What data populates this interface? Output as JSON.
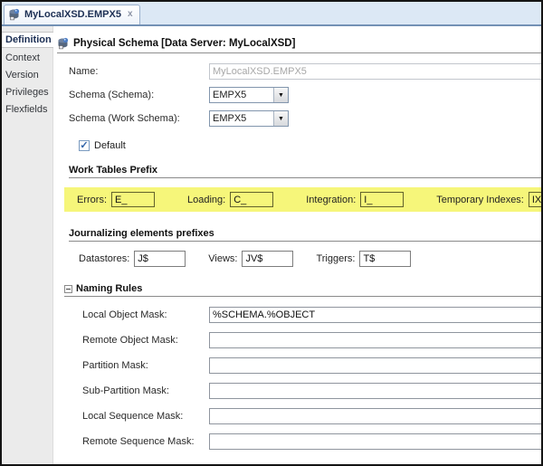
{
  "tab": {
    "title": "MyLocalXSD.EMPX5",
    "close_glyph": "x"
  },
  "sidebar": {
    "items": [
      {
        "label": "Definition",
        "active": true
      },
      {
        "label": "Context",
        "active": false
      },
      {
        "label": "Version",
        "active": false
      },
      {
        "label": "Privileges",
        "active": false
      },
      {
        "label": "Flexfields",
        "active": false
      }
    ]
  },
  "header": {
    "title": "Physical Schema [Data Server: MyLocalXSD]"
  },
  "form": {
    "name": {
      "label": "Name:",
      "value": "MyLocalXSD.EMPX5",
      "disabled": true
    },
    "schema": {
      "label": "Schema (Schema):",
      "value": "EMPX5"
    },
    "work_schema": {
      "label": "Schema (Work Schema):",
      "value": "EMPX5"
    },
    "default_checkbox": {
      "label": "Default",
      "checked": true,
      "check_glyph": "✓"
    },
    "work_tables_prefix": {
      "heading": "Work Tables Prefix",
      "fields": [
        {
          "label": "Errors:",
          "value": "E_"
        },
        {
          "label": "Loading:",
          "value": "C_"
        },
        {
          "label": "Integration:",
          "value": "I_"
        },
        {
          "label": "Temporary Indexes:",
          "value": "IX_"
        }
      ]
    },
    "journalizing": {
      "heading": "Journalizing elements prefixes",
      "fields": [
        {
          "label": "Datastores:",
          "value": "J$"
        },
        {
          "label": "Views:",
          "value": "JV$"
        },
        {
          "label": "Triggers:",
          "value": "T$"
        }
      ]
    },
    "naming_rules": {
      "heading": "Naming Rules",
      "collapsed": false,
      "fields": [
        {
          "label": "Local Object Mask:",
          "value": "%SCHEMA.%OBJECT"
        },
        {
          "label": "Remote Object Mask:",
          "value": ""
        },
        {
          "label": "Partition Mask:",
          "value": ""
        },
        {
          "label": "Sub-Partition Mask:",
          "value": ""
        },
        {
          "label": "Local Sequence Mask:",
          "value": ""
        },
        {
          "label": "Remote Sequence Mask:",
          "value": ""
        }
      ]
    }
  },
  "icons": {
    "tab_icon": "physical-schema-icon",
    "header_icon": "physical-schema-icon",
    "combo_arrow": "dropdown-arrow-icon",
    "combo_arrow_glyph": "▼"
  },
  "colors": {
    "highlight_yellow": "#f6f67a",
    "tabbar_blue": "#dce8f5",
    "tab_border_blue": "#7391b5",
    "sidebar_gray": "#ebebeb",
    "active_text_navy": "#1c2f54",
    "disabled_text_gray": "#a7a7a7",
    "window_border": "#141414"
  }
}
